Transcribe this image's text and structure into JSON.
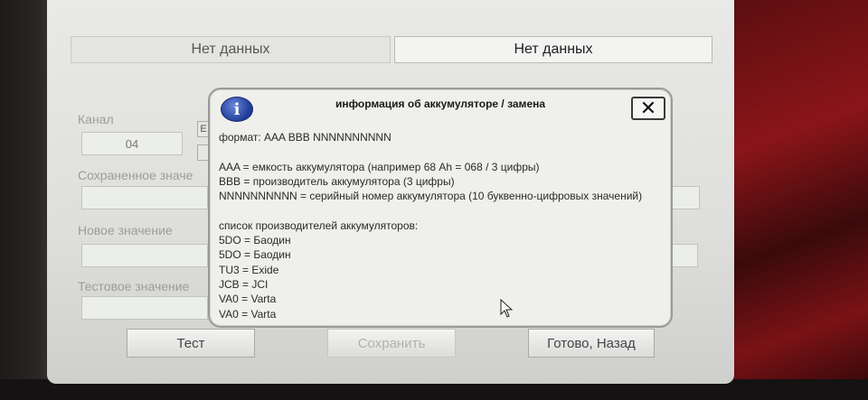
{
  "tabs": [
    {
      "label": "Нет данных",
      "active": false
    },
    {
      "label": "Нет данных",
      "active": true
    }
  ],
  "form": {
    "channel_label": "Канал",
    "channel_value": "04",
    "small_box_1": "E",
    "stored_label": "Сохраненное значе",
    "new_label": "Новое значение",
    "test_label": "Тестовое значение"
  },
  "buttons": {
    "test": "Тест",
    "save": "Сохранить",
    "done": "Готово, Назад"
  },
  "dialog": {
    "icon": "info-icon",
    "title": "информация об аккумуляторе / замена",
    "close_glyph": "✕",
    "lines": [
      "формат: AAA BBB NNNNNNNNNN",
      "",
      "AAA = емкость аккумулятора (например 68 Ah = 068 / 3 цифры)",
      "BBB = производитель аккумулятора (3 цифры)",
      "NNNNNNNNNN = серийный номер аккумулятора (10 буквенно-цифровых значений)",
      "",
      "список производителей аккумуляторов:",
      "5DO = Баодин",
      "5DO = Баодин",
      "TU3 = Exide",
      "JCB = JCI",
      "VA0 = Varta",
      "VA0 = Varta"
    ]
  },
  "colors": {
    "dialog_bg": "#efefec",
    "info_icon": "#1d3b98",
    "screen_bg": "#e9eae8"
  }
}
